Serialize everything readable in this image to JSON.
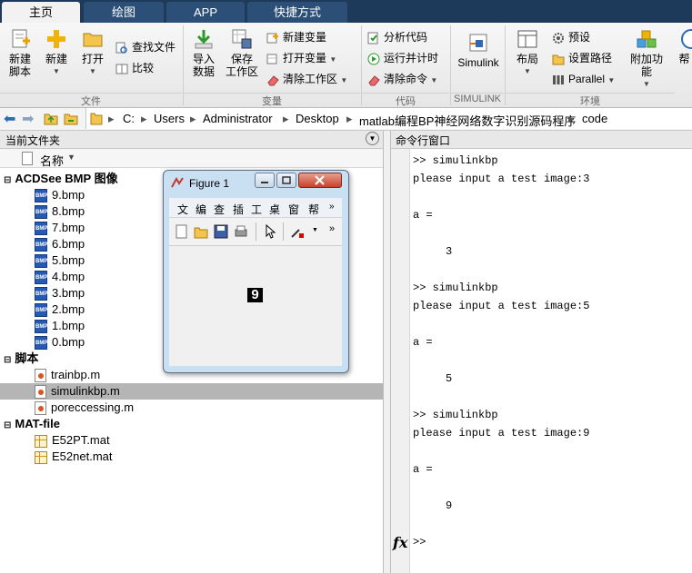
{
  "tabs": [
    "主页",
    "绘图",
    "APP",
    "快捷方式"
  ],
  "ribbon": {
    "file_group": "文件",
    "variable_group": "变量",
    "code_group": "代码",
    "simulink_group": "SIMULINK",
    "env_group": "环境",
    "new_script": "新建\n脚本",
    "new": "新建",
    "open": "打开",
    "find_files": "查找文件",
    "compare": "比较",
    "import_data": "导入\n数据",
    "save_workspace": "保存\n工作区",
    "new_variable": "新建变量",
    "open_variable": "打开变量",
    "clear_workspace": "清除工作区",
    "analyze_code": "分析代码",
    "run_and_time": "运行并计时",
    "clear_commands": "清除命令",
    "simulink": "Simulink",
    "layout": "布局",
    "preferences": "预设",
    "set_path": "设置路径",
    "parallel": "Parallel",
    "addons": "附加功能",
    "help_partial": "帮"
  },
  "address": {
    "crumbs": [
      "C:",
      "Users",
      "Administrator",
      "Desktop",
      "matlab编程BP神经网络数字识别源码程序",
      "code"
    ]
  },
  "current_folder": {
    "title": "当前文件夹",
    "column": "名称",
    "groups": [
      {
        "name": "ACDSee BMP 图像",
        "files": [
          "9.bmp",
          "8.bmp",
          "7.bmp",
          "6.bmp",
          "5.bmp",
          "4.bmp",
          "3.bmp",
          "2.bmp",
          "1.bmp",
          "0.bmp"
        ]
      },
      {
        "name": "脚本",
        "files": [
          "trainbp.m",
          "simulinkbp.m",
          "poreccessing.m"
        ],
        "selected": "simulinkbp.m"
      },
      {
        "name": "MAT-file",
        "files": [
          "E52PT.mat",
          "E52net.mat"
        ]
      }
    ]
  },
  "command_window": {
    "title": "命令行窗口",
    "lines": [
      ">> simulinkbp",
      "please input a test image:3",
      "",
      "a =",
      "",
      "     3",
      "",
      ">> simulinkbp",
      "please input a test image:5",
      "",
      "a =",
      "",
      "     5",
      "",
      ">> simulinkbp",
      "please input a test image:9",
      "",
      "a =",
      "",
      "     9"
    ],
    "prompt": ">>",
    "fx": "fx"
  },
  "figure": {
    "title": "Figure 1",
    "menu": [
      "文",
      "编",
      "查",
      "插",
      "工",
      "桌",
      "窗",
      "帮"
    ],
    "digit": "9"
  },
  "colors": {
    "accent": "#1e3a5a",
    "selected_row": "#b5b5b5",
    "figure_frame": "#c9dff2"
  }
}
